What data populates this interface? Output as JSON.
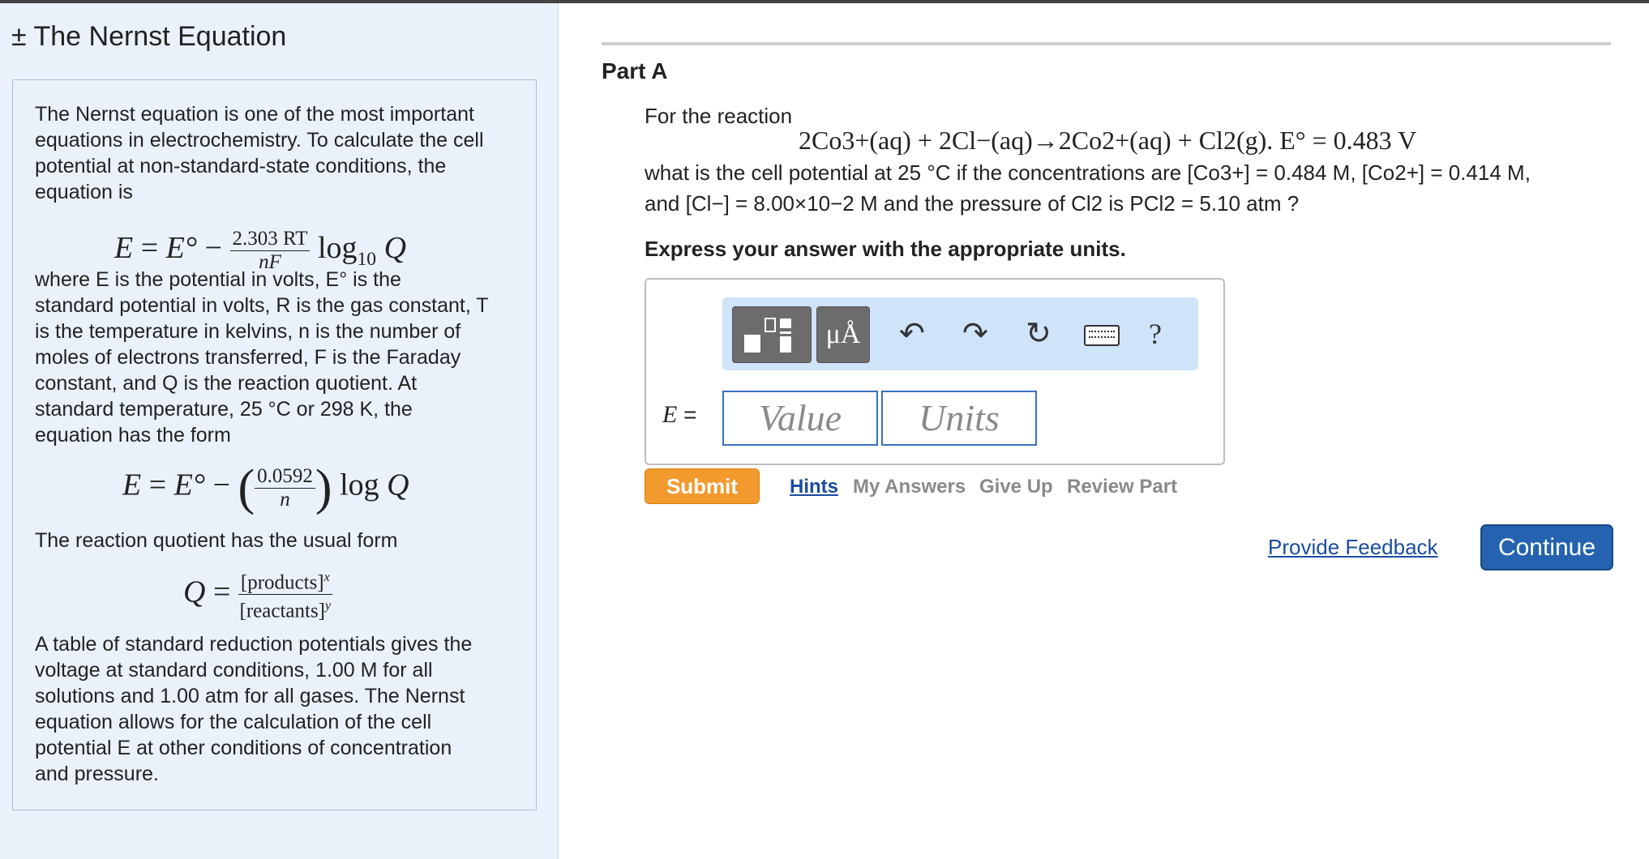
{
  "left_panel": {
    "title": "± The Nernst Equation",
    "intro": "The Nernst equation is one of the most important equations in electrochemistry. To calculate the cell potential at non-standard-state conditions, the equation is",
    "eq1": {
      "lhs": "E",
      "e0": "E°",
      "num": "2.303 RT",
      "den": "nF",
      "log": "log",
      "logsub": "10",
      "q": "Q"
    },
    "where_lines": [
      "where E is the potential in volts, E° is the",
      "standard potential in volts, R is the gas constant, T",
      " is the temperature in kelvins, n is the number of",
      "moles of electrons transferred, F is the Faraday",
      "constant, and Q is the reaction quotient. At",
      "standard temperature, 25 °C or 298 K, the",
      "equation has the form"
    ],
    "eq2": {
      "num": "0.0592",
      "den": "n",
      "log": "log",
      "q": "Q"
    },
    "quotient_intro": "The reaction quotient has the usual form",
    "eq3": {
      "q": "Q",
      "num": "[products]",
      "num_exp": "x",
      "den": "[reactants]",
      "den_exp": "y"
    },
    "table_lines": [
      "A table of standard reduction potentials gives the",
      "voltage at standard conditions, 1.00 M for all",
      "solutions and 1.00 atm for all gases. The Nernst",
      "equation allows for the calculation of the cell",
      "potential E at other conditions of concentration",
      "and pressure."
    ]
  },
  "part": {
    "label": "Part A",
    "for_reaction": "For the reaction",
    "reaction": "2Co3+(aq) + 2Cl−(aq)→2Co2+(aq) + Cl2(g).  E° = 0.483 V",
    "question_line1": "what is the cell potential at 25 °C if the concentrations are [Co3+] = 0.484 M, [Co2+] = 0.414 M,",
    "question_line2": "and [Cl−] = 8.00×10−2 M and the pressure of Cl2 is PCl2 = 5.10 atm ?",
    "express": "Express your answer with the appropriate units."
  },
  "answer": {
    "variable": "E =",
    "value_placeholder": "Value",
    "units_placeholder": "Units",
    "toolbar": {
      "templates_icon": "templates-icon",
      "units_label": "μÅ",
      "undo_icon": "undo-icon",
      "redo_icon": "redo-icon",
      "reset_icon": "reset-icon",
      "keyboard_icon": "keyboard-icon",
      "help_label": "?"
    }
  },
  "actions": {
    "submit": "Submit",
    "hints": "Hints",
    "my_answers": "My Answers",
    "give_up": "Give Up",
    "review_part": "Review Part",
    "feedback": "Provide Feedback",
    "continue": "Continue"
  },
  "colors": {
    "left_bg": "#eaf1fb",
    "submit": "#f29a2e",
    "continue": "#2563b0",
    "link": "#1a4d9e",
    "toolbar": "#cfe3f9"
  }
}
